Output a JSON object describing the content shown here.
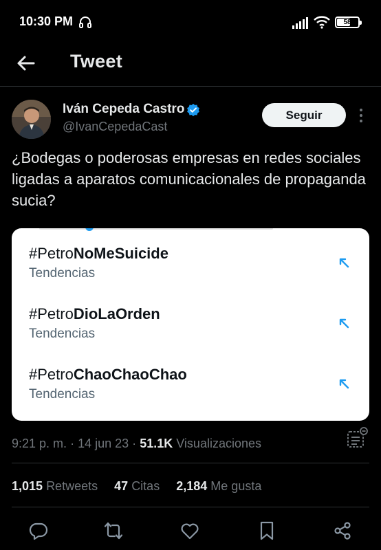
{
  "status_bar": {
    "time": "10:30 PM",
    "battery": "58",
    "battery_level": 0.58
  },
  "header": {
    "title": "Tweet"
  },
  "author": {
    "name": "Iván Cepeda Castro",
    "handle": "@IvanCepedaCast"
  },
  "follow_button": {
    "label": "Seguir"
  },
  "tweet": {
    "text": "¿Bodegas o poderosas empresas en redes sociales ligadas a aparatos comunicacionales de propaganda sucia?"
  },
  "trends": [
    {
      "prefix": "#Petro",
      "bold": "NoMeSuicide",
      "subtitle": "Tendencias"
    },
    {
      "prefix": "#Petro",
      "bold": "DioLaOrden",
      "subtitle": "Tendencias"
    },
    {
      "prefix": "#Petro",
      "bold": "ChaoChaoChao",
      "subtitle": "Tendencias"
    }
  ],
  "meta": {
    "time": "9:21 p. m.",
    "date": "14 jun 23",
    "separator": "·",
    "views_count": "51.1K",
    "views_label": "Visualizaciones"
  },
  "stats": {
    "retweets_count": "1,015",
    "retweets_label": "Retweets",
    "quotes_count": "47",
    "quotes_label": "Citas",
    "likes_count": "2,184",
    "likes_label": "Me gusta"
  },
  "colors": {
    "background": "#000000",
    "accent": "#1d9bf0",
    "text": "#e7e9ea",
    "muted": "#71767b"
  },
  "icons": [
    "headphone-icon",
    "signal-icon",
    "wifi-icon",
    "back-arrow-icon",
    "verified-icon",
    "more-icon",
    "trend-arrow-icon",
    "analytics-icon",
    "reply-icon",
    "retweet-icon",
    "like-icon",
    "bookmark-icon",
    "share-icon"
  ]
}
